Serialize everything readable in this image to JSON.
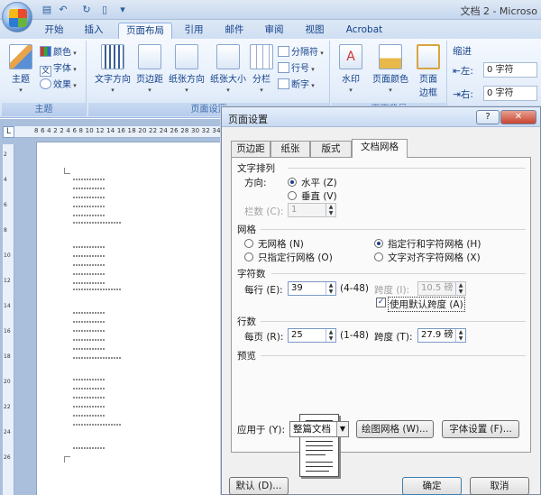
{
  "window": {
    "title": "文档 2 - Microso"
  },
  "quick_access": {
    "undo": "↶",
    "redo": "↻",
    "save": "▤",
    "customize": "▾"
  },
  "tabs": [
    "开始",
    "插入",
    "页面布局",
    "引用",
    "邮件",
    "审阅",
    "视图",
    "Acrobat"
  ],
  "active_tab": "页面布局",
  "ribbon": {
    "theme_group": {
      "label": "主题",
      "theme": "主题",
      "colors": "颜色",
      "fonts": "字体",
      "effects": "效果"
    },
    "page_setup_group": {
      "label": "页面设置",
      "text_direction": "文字方向",
      "margins": "页边距",
      "orientation": "纸张方向",
      "size": "纸张大小",
      "columns": "分栏",
      "breaks": "分隔符",
      "line_numbers": "行号",
      "hyphenation": "断字"
    },
    "page_background_group": {
      "label": "页面背景",
      "watermark": "水印",
      "page_color": "页面颜色",
      "page_borders_line1": "页面",
      "page_borders_line2": "边框"
    },
    "paragraph_group": {
      "indent": "缩进",
      "left_label": "左",
      "left_value": "0 字符",
      "right_label": "右",
      "right_value": "0 字符"
    }
  },
  "ruler": {
    "numbers": "8 6 4 2 2 4 6 8 10 12 14 16 18 20 22 24 26 28 30 32 34",
    "vertical_marks": [
      "2",
      "4",
      "6",
      "8",
      "10",
      "12",
      "14",
      "16",
      "18",
      "20",
      "22",
      "24",
      "26"
    ]
  },
  "dialog": {
    "title": "页面设置",
    "help": "?",
    "close": "✕",
    "tabs": [
      "页边距",
      "纸张",
      "版式",
      "文档网格"
    ],
    "active_tab": "文档网格",
    "text_flow": {
      "section": "文字排列",
      "direction_label": "方向:",
      "horizontal": "水平 (Z)",
      "vertical": "垂直 (V)",
      "horizontal_selected": true,
      "columns_label": "栏数 (C):",
      "columns_value": "1"
    },
    "grid": {
      "section": "网格",
      "options": [
        "无网格 (N)",
        "只指定行网格 (O)",
        "指定行和字符网格 (H)",
        "文字对齐字符网格 (X)"
      ],
      "selected": "指定行和字符网格 (H)"
    },
    "characters": {
      "section": "字符数",
      "per_line_label": "每行 (E):",
      "per_line_value": "39",
      "per_line_range": "(4-48)",
      "pitch_label": "跨度 (I):",
      "pitch_value": "10.5 磅",
      "use_default_label": "使用默认跨度 (A)",
      "use_default_checked": true
    },
    "lines": {
      "section": "行数",
      "per_page_label": "每页 (R):",
      "per_page_value": "25",
      "per_page_range": "(1-48)",
      "pitch_label": "跨度 (T):",
      "pitch_value": "27.9 磅"
    },
    "preview": {
      "section": "预览"
    },
    "apply_to_label": "应用于 (Y):",
    "apply_to_value": "整篇文档",
    "draw_grid_button": "绘图网格 (W)...",
    "font_settings_button": "字体设置 (F)...",
    "default_button": "默认 (D)...",
    "ok_button": "确定",
    "cancel_button": "取消"
  }
}
